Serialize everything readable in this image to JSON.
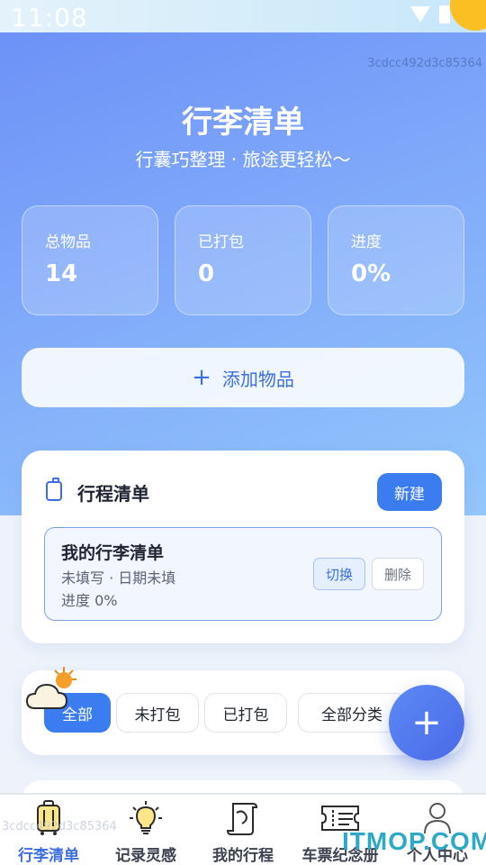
{
  "status_bar": {
    "time": "11:08"
  },
  "header": {
    "device_id": "3cdcc492d3c85364",
    "title": "行李清单",
    "subtitle": "行囊巧整理 · 旅途更轻松～"
  },
  "stats": [
    {
      "label": "总物品",
      "value": "14"
    },
    {
      "label": "已打包",
      "value": "0"
    },
    {
      "label": "进度",
      "value": "0%"
    }
  ],
  "add_item": {
    "label": "添加物品"
  },
  "trip_list": {
    "title": "行程清单",
    "new_label": "新建",
    "item": {
      "name": "我的行李清单",
      "meta": "未填写 · 日期未填",
      "progress": "进度 0%",
      "switch_label": "切换",
      "delete_label": "删除"
    }
  },
  "filters": [
    "全部",
    "未打包",
    "已打包",
    "全部分类"
  ],
  "fab": {
    "label": "+"
  },
  "tabs": [
    {
      "label": "行李清单",
      "icon": "suitcase-icon"
    },
    {
      "label": "记录灵感",
      "icon": "lightbulb-icon"
    },
    {
      "label": "我的行程",
      "icon": "scroll-map-icon"
    },
    {
      "label": "车票纪念册",
      "icon": "ticket-icon"
    },
    {
      "label": "个人中心",
      "icon": "person-icon"
    }
  ],
  "watermark": {
    "id": "3cdcc492d3c85364",
    "logo": "ITMOP.COM"
  },
  "colors": {
    "accent": "#3b7cf0",
    "hero_start": "#6b8ff7",
    "hero_end": "#93c7fb"
  }
}
